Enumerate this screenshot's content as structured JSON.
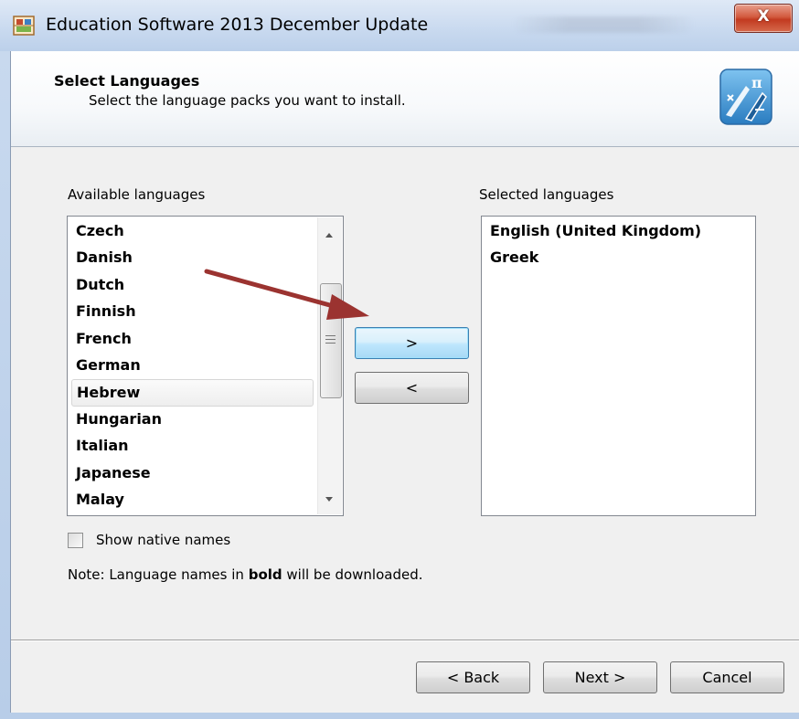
{
  "window": {
    "title": "Education Software 2013 December Update",
    "close_label": "X"
  },
  "header": {
    "title": "Select Languages",
    "subtitle": "Select the language packs you want to install.",
    "icon": "math-tools-icon"
  },
  "available": {
    "label": "Available languages",
    "items": [
      "Czech",
      "Danish",
      "Dutch",
      "Finnish",
      "French",
      "German",
      "Hebrew",
      "Hungarian",
      "Italian",
      "Japanese",
      "Malay"
    ],
    "highlighted": "Hebrew"
  },
  "selected": {
    "label": "Selected languages",
    "items": [
      "English (United Kingdom)",
      "Greek"
    ]
  },
  "transfer": {
    "add_label": ">",
    "remove_label": "<"
  },
  "options": {
    "show_native_label": "Show native names",
    "show_native_checked": false,
    "note_prefix": "Note: Language names in ",
    "note_bold": "bold",
    "note_suffix": " will be downloaded."
  },
  "footer": {
    "back_label": "< Back",
    "next_label": "Next >",
    "cancel_label": "Cancel"
  },
  "colors": {
    "annotation_arrow": "#9b3330",
    "focus_border": "#3c7fb1"
  }
}
